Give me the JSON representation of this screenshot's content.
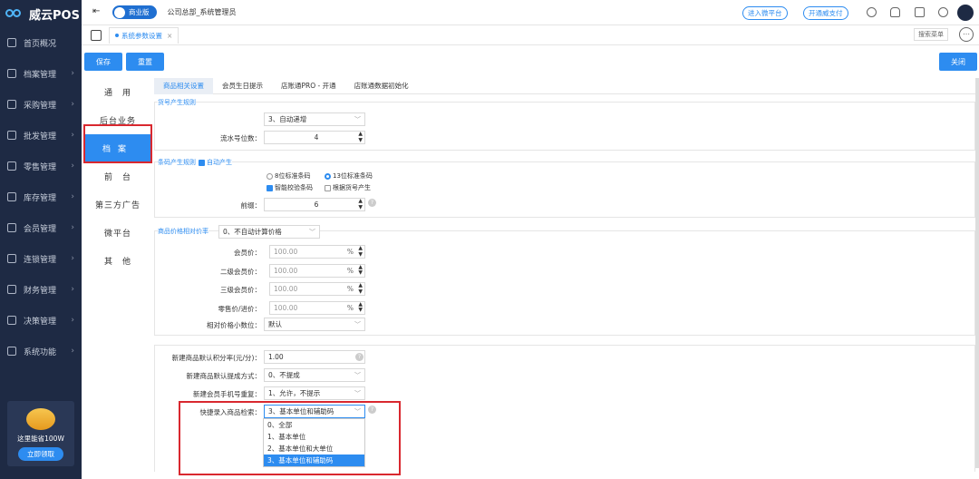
{
  "sidebar": {
    "logo": "威云POS",
    "items": [
      {
        "label": "首页概况",
        "icon": "home-icon"
      },
      {
        "label": "档案管理",
        "icon": "archive-icon"
      },
      {
        "label": "采购管理",
        "icon": "cart-icon"
      },
      {
        "label": "批发管理",
        "icon": "wholesale-icon"
      },
      {
        "label": "零售管理",
        "icon": "retail-icon"
      },
      {
        "label": "库存管理",
        "icon": "inventory-icon"
      },
      {
        "label": "会员管理",
        "icon": "member-icon"
      },
      {
        "label": "连锁管理",
        "icon": "chain-icon"
      },
      {
        "label": "财务管理",
        "icon": "finance-icon"
      },
      {
        "label": "决策管理",
        "icon": "decision-icon"
      },
      {
        "label": "系统功能",
        "icon": "system-icon"
      }
    ],
    "promo_text": "这里能省100W",
    "promo_button": "立即领取"
  },
  "topbar": {
    "version": "商业版",
    "company": "公司总部_系统管理员",
    "link1": "进入微平台",
    "link2": "开通威支付"
  },
  "tabs": {
    "active_tab": "系统参数设置",
    "close": "×",
    "search_label": "搜索菜单",
    "more": "⋯"
  },
  "toolbar": {
    "save": "保存",
    "reset": "重置",
    "close": "关闭"
  },
  "left_nav": [
    "通　用",
    "后台业务",
    "档案",
    "前　台",
    "第三方广告",
    "微平台",
    "其　他"
  ],
  "sub_tabs": [
    "商品相关设置",
    "会员生日提示",
    "店账通PRO - 开通",
    "店账通数据初始化"
  ],
  "goods_code": {
    "title": "货号产生规则",
    "rule_value": "3、自动递增",
    "serial_label": "流水号位数：",
    "serial_value": "4"
  },
  "barcode": {
    "title": "条码产生规则",
    "auto_label": "自动产生",
    "opt_8": "8位标准条码",
    "opt_13": "13位标准条码",
    "smart_check": "智能校验条码",
    "by_goods_code": "根据货号产生",
    "prefix_label": "前缀：",
    "prefix_value": "6"
  },
  "price_ratio": {
    "title": "商品价格相对价率",
    "mode_value": "0、不自动计算价格",
    "rows": [
      {
        "label": "会员价：",
        "value": "100.00",
        "unit": "%"
      },
      {
        "label": "二级会员价：",
        "value": "100.00",
        "unit": "%"
      },
      {
        "label": "三级会员价：",
        "value": "100.00",
        "unit": "%"
      },
      {
        "label": "零售价/进价：",
        "value": "100.00",
        "unit": "%"
      }
    ],
    "decimal_label": "相对价格小数位：",
    "decimal_value": "默认"
  },
  "misc": {
    "points_label": "新建商品默认积分率(元/分)：",
    "points_value": "1.00",
    "commission_label": "新建商品默认提成方式：",
    "commission_value": "0、不提成",
    "phone_label": "新建会员手机号重复：",
    "phone_value": "1、允许，不提示",
    "quick_label": "快捷录入商品检索：",
    "quick_value": "3、基本单位和辅助码",
    "options": [
      "0、全部",
      "1、基本单位",
      "2、基本单位和大单位",
      "3、基本单位和辅助码"
    ]
  }
}
